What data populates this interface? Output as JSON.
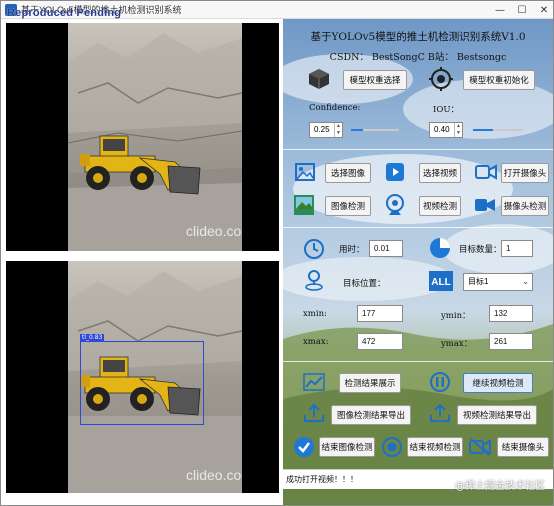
{
  "window": {
    "title": "基于YOLOv5模型的推土机检测识别系统",
    "watermark": "Reproduced Pending",
    "buttons": {
      "minimize": "—",
      "maximize": "☐",
      "close": "✕"
    }
  },
  "video": {
    "top_watermark": "clideo.com",
    "bottom_watermark": "clideo.com",
    "detection_label": "tl_0.83"
  },
  "panel": {
    "title": "基于YOLOv5模型的推土机检测识别系统V1.0",
    "subtitle": "CSDN：  BestSongC   B站：  Bestsongc",
    "model_select": "模型权重选择",
    "model_init": "模型权重初始化",
    "confidence_label": "Confidence:",
    "confidence_value": "0.25",
    "iou_label": "IOU：",
    "iou_value": "0.40",
    "confidence_level": 0.25,
    "iou_level": 0.4,
    "select_image": "选择图像",
    "select_video": "选择视频",
    "open_camera": "打开摄像头",
    "image_detect": "图像检测",
    "video_detect": "视频检测",
    "camera_detect": "摄像头检测",
    "time_label": "用时：",
    "time_value": "0.01",
    "count_label": "目标数量：",
    "count_value": "1",
    "position_label": "目标位置：",
    "target_select": "目标1",
    "xmin_label": "xmin:",
    "xmin_value": "177",
    "ymin_label": "ymin：",
    "ymin_value": "132",
    "xmax_label": "xmax:",
    "xmax_value": "472",
    "ymax_label": "ymax：",
    "ymax_value": "261",
    "show_results": "检测结果展示",
    "continue_video": "继续视频检测",
    "export_image": "图像检测结果导出",
    "export_video": "视频检测结果导出",
    "end_image": "结束图像检测",
    "end_video": "结束视频检测",
    "end_camera": "结束摄像头"
  },
  "status": {
    "message": "成功打开视频！！！",
    "watermark": "@稀土掘金技术社区"
  },
  "colors": {
    "accent": "#2a7ad6",
    "box": "#2f4ad8",
    "loader": "#e3b416"
  }
}
